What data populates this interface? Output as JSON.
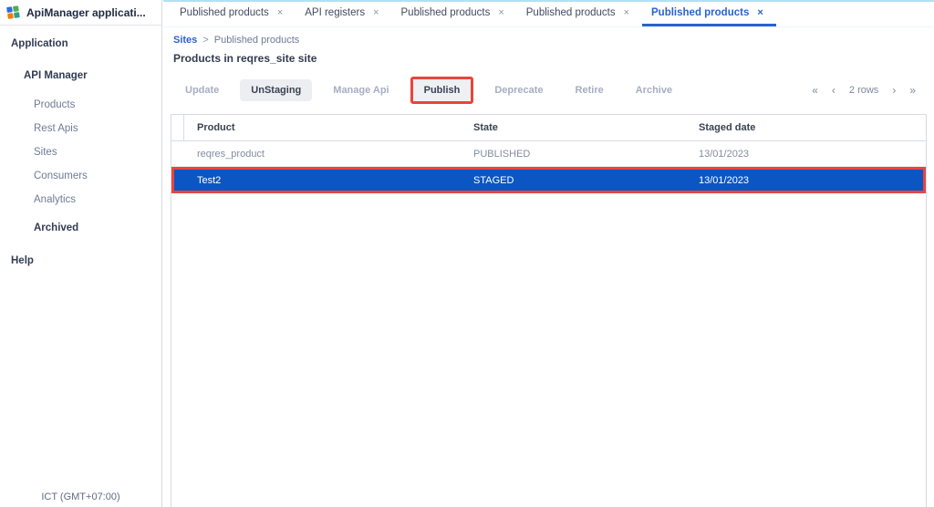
{
  "sidebar": {
    "app_title": "ApiManager applicati...",
    "items": [
      {
        "label": "Application"
      },
      {
        "label": "API Manager"
      },
      {
        "label": "Products"
      },
      {
        "label": "Rest Apis"
      },
      {
        "label": "Sites"
      },
      {
        "label": "Consumers"
      },
      {
        "label": "Analytics"
      },
      {
        "label": "Archived"
      },
      {
        "label": "Help"
      }
    ],
    "timezone": "ICT (GMT+07:00)"
  },
  "tabs": [
    {
      "label": "Published products",
      "close": "×",
      "active": false
    },
    {
      "label": "API registers",
      "close": "×",
      "active": false
    },
    {
      "label": "Published products",
      "close": "×",
      "active": false
    },
    {
      "label": "Published products",
      "close": "×",
      "active": false
    },
    {
      "label": "Published products",
      "close": "×",
      "active": true
    }
  ],
  "breadcrumb": {
    "parent": "Sites",
    "separator": ">",
    "current": "Published products"
  },
  "page": {
    "title": "Products in reqres_site site"
  },
  "toolbar": {
    "buttons": [
      {
        "label": "Update",
        "enabled": false
      },
      {
        "label": "UnStaging",
        "enabled": true
      },
      {
        "label": "Manage Api",
        "enabled": false
      },
      {
        "label": "Publish",
        "enabled": true,
        "annotated": true
      },
      {
        "label": "Deprecate",
        "enabled": false
      },
      {
        "label": "Retire",
        "enabled": false
      },
      {
        "label": "Archive",
        "enabled": false
      }
    ],
    "pagination": {
      "first": "«",
      "prev": "‹",
      "label": "2 rows",
      "next": "›",
      "last": "»"
    }
  },
  "table": {
    "columns": [
      "Product",
      "State",
      "Staged date"
    ],
    "rows": [
      {
        "product": "reqres_product",
        "state": "PUBLISHED",
        "staged_date": "13/01/2023",
        "selected": false
      },
      {
        "product": "Test2",
        "state": "STAGED",
        "staged_date": "13/01/2023",
        "selected": true
      }
    ]
  },
  "colors": {
    "accent_blue": "#2a63c9",
    "selected_row_blue": "#0b56c2",
    "annotation_red": "#e8453c"
  }
}
